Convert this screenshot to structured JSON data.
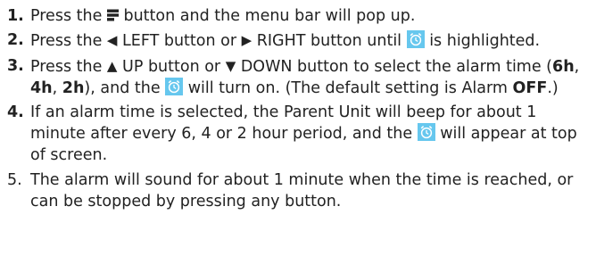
{
  "colors": {
    "text": "#222222",
    "alarm_icon_fill": "#66c7ee",
    "alarm_icon_stroke": "#ffffff"
  },
  "icons": {
    "menu": "menu-icon",
    "left": "left-triangle-icon",
    "right": "right-triangle-icon",
    "up": "up-triangle-icon",
    "down": "down-triangle-icon",
    "alarm": "alarm-clock-icon"
  },
  "steps": [
    {
      "number": "1.",
      "parts": {
        "a": "Press the ",
        "b": " button and the menu bar will pop up."
      }
    },
    {
      "number": "2.",
      "parts": {
        "a": "Press the ",
        "b": " LEFT button or ",
        "c": " RIGHT button until ",
        "d": " is highlighted."
      }
    },
    {
      "number": "3.",
      "parts": {
        "a": "Press the ",
        "b": " UP button or ",
        "c": " DOWN button to select the alarm time (",
        "opt1": "6h",
        "sep1": ", ",
        "opt2": "4h",
        "sep2": ", ",
        "opt3": "2h",
        "d": "), and the ",
        "e": " will turn on. (The default setting is Alarm ",
        "off": "OFF",
        "f": ".)"
      }
    },
    {
      "number": "4.",
      "parts": {
        "a": "If an alarm time is selected, the Parent Unit will beep for about 1 minute after every 6, 4 or 2 hour period, and the ",
        "b": " will appear at top of screen."
      }
    },
    {
      "number": "5.",
      "parts": {
        "a": "The alarm will sound for about 1 minute when the time is reached, or can be stopped by pressing any button."
      }
    }
  ]
}
